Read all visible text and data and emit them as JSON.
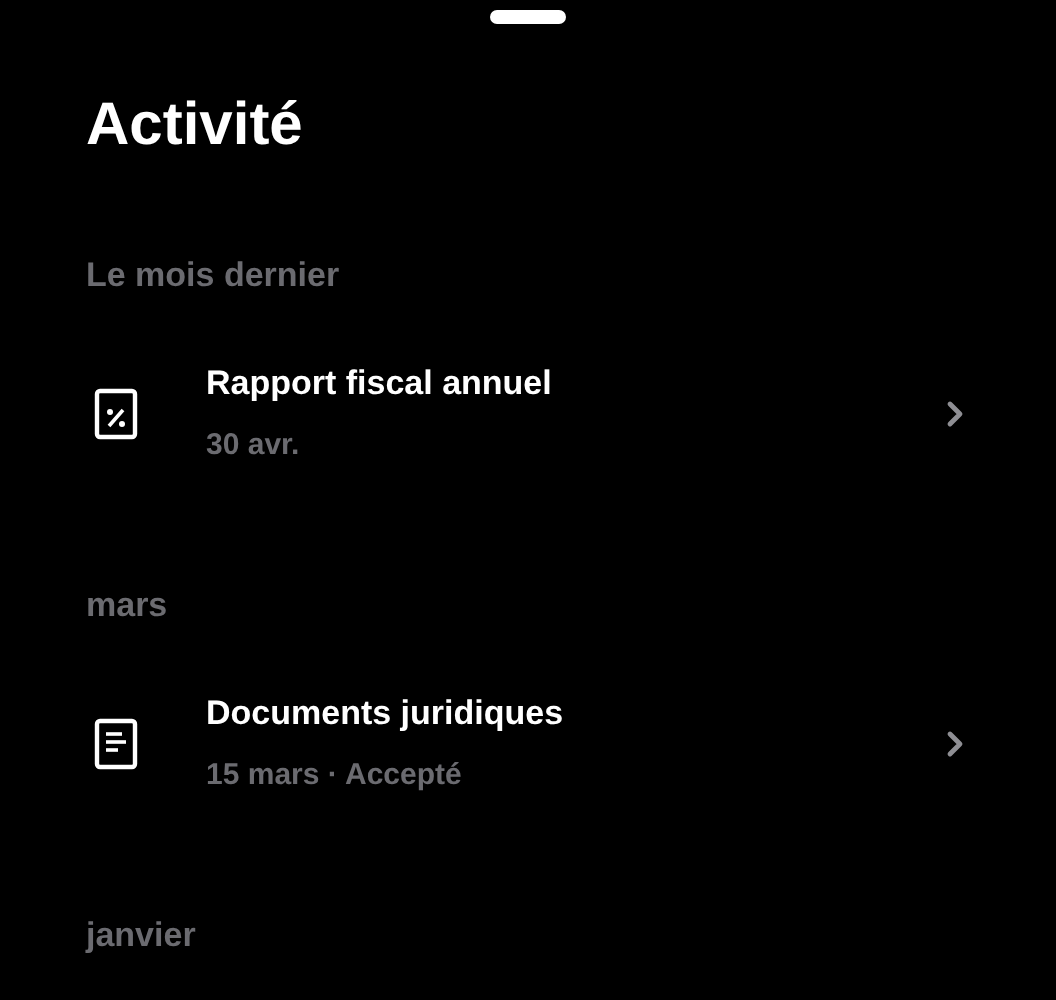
{
  "title": "Activité",
  "sections": [
    {
      "heading": "Le mois dernier",
      "items": [
        {
          "kind": "tax",
          "title": "Rapport fiscal annuel",
          "subtitle": "30 avr."
        }
      ]
    },
    {
      "heading": "mars",
      "items": [
        {
          "kind": "document",
          "title": "Documents juridiques",
          "subtitle": "15 mars · Accepté"
        }
      ]
    },
    {
      "heading": "janvier"
    }
  ]
}
